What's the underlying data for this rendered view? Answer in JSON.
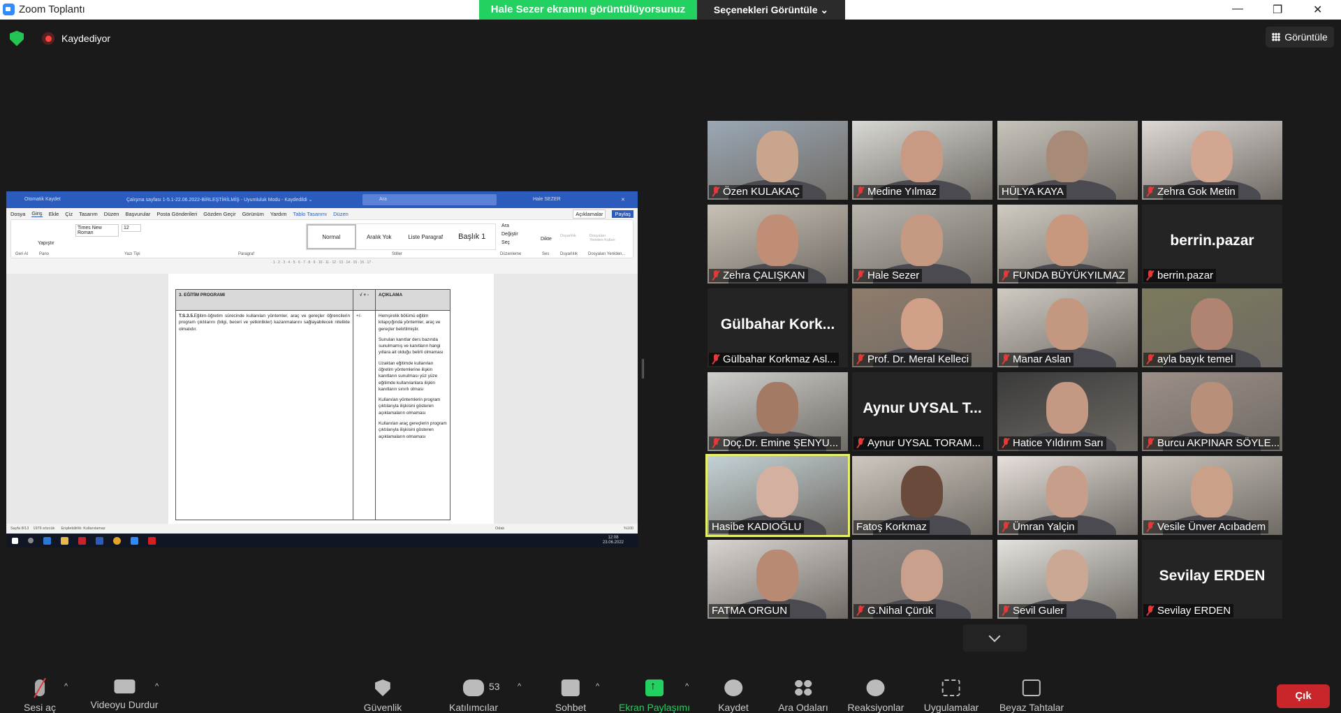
{
  "window": {
    "title": "Zoom Toplantı",
    "banner": "Hale Sezer ekranını görüntülüyorsunuz",
    "view_options": "Seçenekleri Görüntüle ⌄",
    "recording": "Kaydediyor",
    "view_button": "Görüntüle"
  },
  "word": {
    "autosave": "Otomatik Kaydet",
    "doc_title": "Çalışma sayfası 1-5.1-22.06.2022-BİRLEŞTİRİLMİŞ - Uyumluluk Modu - Kaydedildi ⌄",
    "search": "Ara",
    "user": "Hale SEZER",
    "menu": [
      "Dosya",
      "Giriş",
      "Ekle",
      "Çiz",
      "Tasarım",
      "Düzen",
      "Başvurular",
      "Posta Gönderileri",
      "Gözden Geçir",
      "Görünüm",
      "Yardım"
    ],
    "menu_blue": [
      "Tablo Tasarımı",
      "Düzen"
    ],
    "comments": "Açıklamalar",
    "share": "Paylaş",
    "font": "Times New Roman",
    "size": "12",
    "paste": "Yapıştır",
    "styles": [
      "Normal",
      "Aralık Yok",
      "Liste Paragraf",
      "Başlık 1"
    ],
    "find": "Ara",
    "replace": "Değiştir",
    "select": "Seç",
    "dictate": "Dikte",
    "sensitivity": "Duyarlılık",
    "reuse": "Dosyaları Yeniden Kullan",
    "groups": [
      "Geri Al",
      "Pano",
      "Yazı Tipi",
      "Paragraf",
      "Stiller",
      "Düzenleme",
      "Ses",
      "Duyarlılık",
      "Dosyaları Yeniden..."
    ],
    "ruler": "· 1 · 2 · 3 · 4 · 5 · 6 · 7 · 8 · 9 · 10 · 11 · 12 · 13 · 14 · 15 · 16 · 17 ·",
    "table": {
      "h1": "3. EĞİTİM PROGRAMI",
      "h2": "√ + -",
      "h3": "AÇIKLAMA",
      "code": "T.S.3.5.",
      "criterion": "Eğitim-öğretim sürecinde kullanılan yöntemler, araç ve gereçler öğrencilerin program çıktılarını (bilgi, beceri ve yetkinlikler) kazanmalarını sağlayabilecek nitelikte olmalıdır.",
      "mark": "+/-",
      "notes": [
        "Hemşirelik bölümü eğitim kitapçığında yöntemler, araç ve gereçler belirtilmiştir.",
        "Sunulan kanıtlar ders bazında sunulmamış ve kanıtların hangi yıllara ait olduğu belirli olmaması",
        "Uzaktan eğitimde kullanılan öğretim yöntemlerine ilişkin kanıtların sunulması yüz yüze eğitimde kullanılanlara ilişkin kanıtların sınırlı olması",
        "Kullanılan yöntemlerin program çıktılarıyla ilişkisini gösteren açıklamaların olmaması",
        "Kullanılan araç gereçlerin program çıktılarıyla ilişkisini gösteren açıklamaların olmaması"
      ]
    },
    "status": {
      "page": "Sayfa 8/13",
      "words": "1976 sözcük",
      "access": "Erişilebilirlik: Kullanılamaz",
      "focus": "Odak",
      "zoom": "%100"
    },
    "clock": {
      "time": "12:08",
      "date": "23.06.2022"
    }
  },
  "participants": [
    {
      "name": "Özen KULAKAÇ",
      "muted": true,
      "skin": "#c9a58e",
      "bg": "#9aa8b5"
    },
    {
      "name": "Medine Yılmaz",
      "muted": true,
      "skin": "#c89a84",
      "bg": "#d8d8d4"
    },
    {
      "name": "HÜLYA KAYA",
      "muted": false,
      "skin": "#a88a78",
      "bg": "#c7c4bc"
    },
    {
      "name": "Zehra Gok Metin",
      "muted": true,
      "skin": "#d2a690",
      "bg": "#ddd8d4"
    },
    {
      "name": "Zehra ÇALIŞKAN",
      "muted": true,
      "skin": "#c08e76",
      "bg": "#c9c1b5"
    },
    {
      "name": "Hale Sezer",
      "muted": true,
      "skin": "#c69a82",
      "bg": "#b9b6ae"
    },
    {
      "name": "FUNDA BÜYÜKYILMAZ",
      "muted": true,
      "skin": "#c7987e",
      "bg": "#d0cbc2"
    },
    {
      "name": "berrin.pazar",
      "muted": true,
      "label": "berrin.pazar"
    },
    {
      "name": "Gülbahar Korkmaz Asl...",
      "muted": true,
      "label": "Gülbahar Kork..."
    },
    {
      "name": "Prof. Dr. Meral Kelleci",
      "muted": true,
      "skin": "#d0a088",
      "bg": "#8f7c6c"
    },
    {
      "name": "Manar Aslan",
      "muted": true,
      "skin": "#c49880",
      "bg": "#cfcac2"
    },
    {
      "name": "ayla bayık temel",
      "muted": true,
      "skin": "#b08470",
      "bg": "#7c7a5c"
    },
    {
      "name": "Doç.Dr. Emine ŞENYU...",
      "muted": true,
      "skin": "#a37a64",
      "bg": "#cfcfcc"
    },
    {
      "name": "Aynur UYSAL TORAM...",
      "muted": true,
      "label": "Aynur UYSAL T..."
    },
    {
      "name": "Hatice Yıldırım Sarı",
      "muted": true,
      "skin": "#c49882",
      "bg": "#3a3a3a"
    },
    {
      "name": "Burcu AKPINAR SÖYLE...",
      "muted": true,
      "skin": "#b8907a",
      "bg": "#9c8f88"
    },
    {
      "name": "Hasibe KADIOĞLU",
      "muted": false,
      "active": true,
      "skin": "#d3b0a0",
      "bg": "#c4d2d6"
    },
    {
      "name": "Fatoş Korkmaz",
      "muted": false,
      "skin": "#6a4a3a",
      "bg": "#cfc8c0"
    },
    {
      "name": "Ümran Yalçin",
      "muted": true,
      "skin": "#c69e8a",
      "bg": "#e6dfdb"
    },
    {
      "name": "Vesile Ünver Acıbadem",
      "muted": true,
      "skin": "#caa088",
      "bg": "#c6c0b8"
    },
    {
      "name": "FATMA ORGUN",
      "muted": false,
      "skin": "#b88a74",
      "bg": "#d8d4d0"
    },
    {
      "name": "G.Nihal Çürük",
      "muted": true,
      "skin": "#c8a08c",
      "bg": "#8e8886"
    },
    {
      "name": "Sevil Guler",
      "muted": true,
      "skin": "#caa894",
      "bg": "#e4e2de"
    },
    {
      "name": "Sevilay ERDEN",
      "muted": true,
      "label": "Sevilay ERDEN"
    }
  ],
  "toolbar": {
    "unmute": "Sesi aç",
    "video": "Videoyu Durdur",
    "security": "Güvenlik",
    "participants": "Katılımcılar",
    "participant_count": "53",
    "chat": "Sohbet",
    "share": "Ekran Paylaşımı",
    "record": "Kaydet",
    "breakout": "Ara Odaları",
    "reactions": "Reaksiyonlar",
    "apps": "Uygulamalar",
    "whiteboard": "Beyaz Tahtalar",
    "leave": "Çık"
  }
}
